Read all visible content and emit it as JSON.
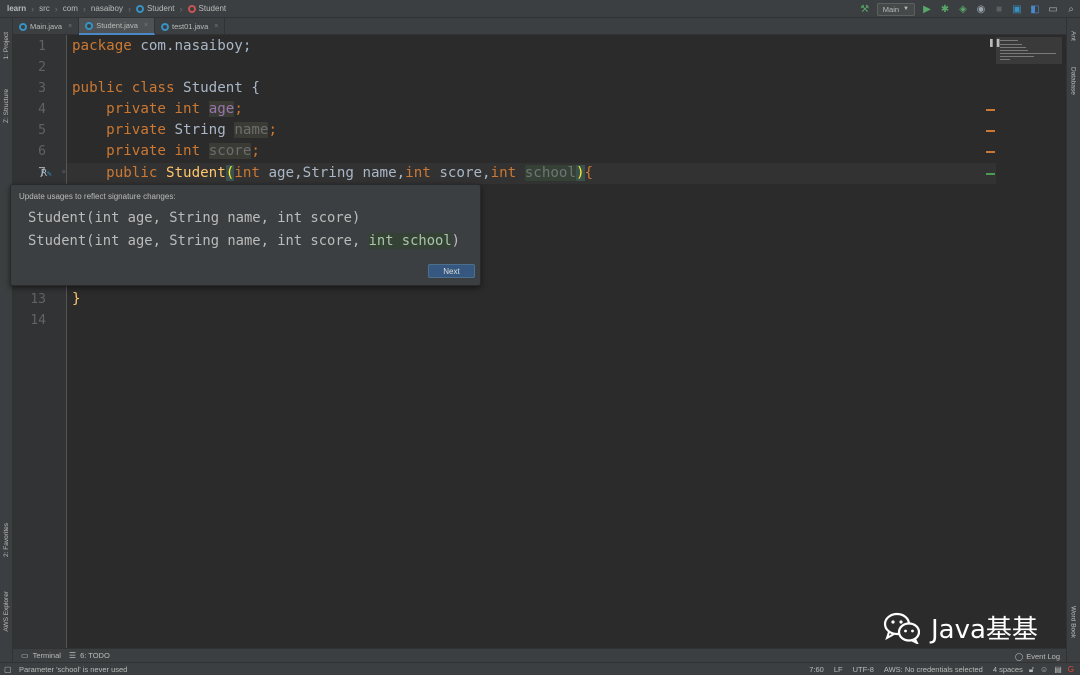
{
  "breadcrumb": [
    "learn",
    "src",
    "com",
    "nasaiboy",
    "Student",
    "Student"
  ],
  "toolbar": {
    "run_config": "Main",
    "icons": [
      "hammer-icon",
      "run-icon",
      "debug-icon",
      "coverage-icon",
      "profile-icon",
      "stop-icon",
      "project-structure-icon",
      "translate-icon",
      "layout-icon",
      "search-icon"
    ]
  },
  "tabs": [
    {
      "label": "Main.java",
      "active": false
    },
    {
      "label": "Student.java",
      "active": true
    },
    {
      "label": "test01.java",
      "active": false
    }
  ],
  "left_tool_tabs": [
    "1: Project",
    "Z: Structure",
    "2: Favorites",
    "AWS Explorer"
  ],
  "right_tool_tabs": [
    "Ant",
    "Database",
    "Word Book"
  ],
  "gutter": {
    "lines_top": [
      "1",
      "2",
      "3",
      "4",
      "5",
      "6",
      "7"
    ],
    "lines_bottom": [
      "13",
      "14"
    ],
    "refactor_marker": "R"
  },
  "code": {
    "l1_kw": "package",
    "l1_rest": " com.nasaiboy;",
    "l3_kw1": "public",
    "l3_kw2": "class",
    "l3_rest": " Student {",
    "l4_kw1": "private",
    "l4_kw2": "int",
    "l4_field": "age",
    "l4_semi": ";",
    "l5_kw": "private",
    "l5_type": " String ",
    "l5_field": "name",
    "l5_semi": ";",
    "l6_kw1": "private",
    "l6_kw2": "int",
    "l6_field": "score",
    "l6_semi": ";",
    "l7_kw": "public",
    "l7_method": "Student",
    "l7_paren": "(",
    "l7_int1": "int",
    "l7_p1": " age,",
    "l7_type2": "String",
    "l7_p2": " name,",
    "l7_int3": "int",
    "l7_p3": " score,",
    "l7_int4": "int",
    "l7_p4": "school",
    "l7_close": ")",
    "l7_brace": "{",
    "l13": "}"
  },
  "popup": {
    "title": "Update usages to reflect signature changes:",
    "old_signature": "Student(int age, String name, int score)",
    "new_signature_prefix": "Student(int age, String name, int score, ",
    "new_signature_added": "int school",
    "new_signature_suffix": ")",
    "next_label": "Next"
  },
  "watermark": "Java基基",
  "bottom_tools": {
    "terminal": "Terminal",
    "todo": "6: TODO",
    "event_log": "Event Log"
  },
  "status": {
    "message": "Parameter 'school' is never used",
    "position": "7:60",
    "line_sep": "LF",
    "encoding": "UTF-8",
    "aws": "AWS: No credentials selected",
    "indent": "4 spaces"
  },
  "colors": {
    "keyword": "#cc7832",
    "method": "#ffc66d",
    "field": "#9876aa",
    "accent": "#365880"
  }
}
